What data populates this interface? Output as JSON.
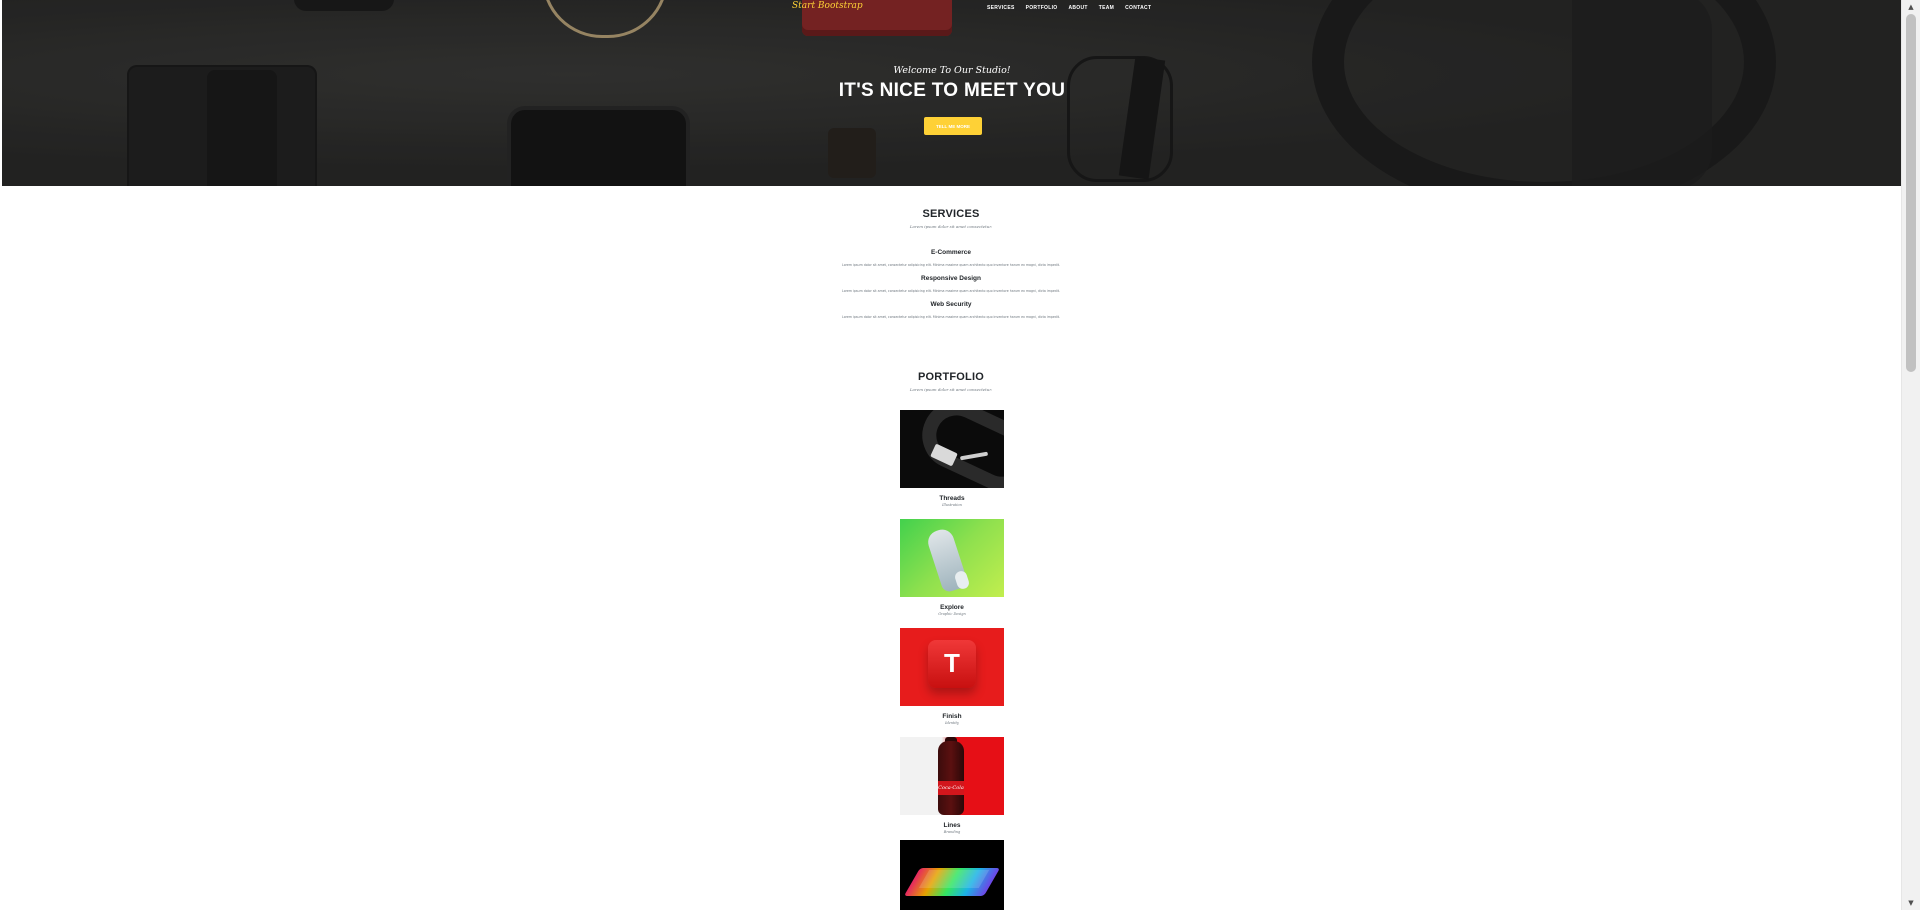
{
  "brand": "Start Bootstrap",
  "nav": {
    "items": [
      {
        "label": "SERVICES"
      },
      {
        "label": "PORTFOLIO"
      },
      {
        "label": "ABOUT"
      },
      {
        "label": "TEAM"
      },
      {
        "label": "CONTACT"
      }
    ]
  },
  "hero": {
    "subheading": "Welcome To Our Studio!",
    "heading": "IT'S NICE TO MEET YOU",
    "button": "TELL ME MORE"
  },
  "services": {
    "title": "SERVICES",
    "subtitle": "Lorem ipsum dolor sit amet consectetur.",
    "items": [
      {
        "title": "E-Commerce",
        "text": "Lorem ipsum dolor sit amet, consectetur adipisicing elit. Minima maxime quam architecto quo inventore harum ex magni, dicta impedit."
      },
      {
        "title": "Responsive Design",
        "text": "Lorem ipsum dolor sit amet, consectetur adipisicing elit. Minima maxime quam architecto quo inventore harum ex magni, dicta impedit."
      },
      {
        "title": "Web Security",
        "text": "Lorem ipsum dolor sit amet, consectetur adipisicing elit. Minima maxime quam architecto quo inventore harum ex magni, dicta impedit."
      }
    ]
  },
  "portfolio": {
    "title": "PORTFOLIO",
    "subtitle": "Lorem ipsum dolor sit amet consectetur.",
    "items": [
      {
        "name": "Threads",
        "category": "Illustration"
      },
      {
        "name": "Explore",
        "category": "Graphic Design"
      },
      {
        "name": "Finish",
        "category": "Identity"
      },
      {
        "name": "Lines",
        "category": "Branding"
      },
      {
        "name": "",
        "category": ""
      }
    ]
  },
  "colors": {
    "accent": "#fed136",
    "text_dark": "#212529",
    "text_muted": "#6c757d",
    "hero_bg": "#2f2f2e"
  },
  "icons": {
    "scroll_up": "scroll-up-arrow-icon",
    "scroll_down": "scroll-down-arrow-icon"
  }
}
